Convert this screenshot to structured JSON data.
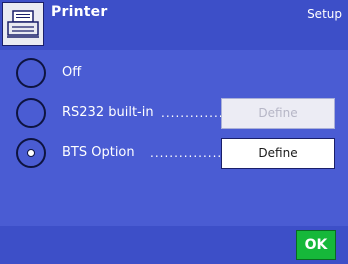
{
  "header": {
    "title": "Printer",
    "section": "Setup",
    "icon": "printer-icon"
  },
  "options": [
    {
      "label": "Off",
      "selected": false,
      "has_define": false
    },
    {
      "label": "RS232 built-in",
      "dots": "..............",
      "selected": false,
      "has_define": true,
      "define_label": "Define",
      "define_enabled": false
    },
    {
      "label": "BTS Option",
      "dots": "..................",
      "selected": true,
      "has_define": true,
      "define_label": "Define",
      "define_enabled": true
    }
  ],
  "footer": {
    "ok_label": "OK"
  },
  "colors": {
    "title_bar": "#3d4fc8",
    "content_bg": "#4a5cd3",
    "ok_button": "#16b83a"
  }
}
